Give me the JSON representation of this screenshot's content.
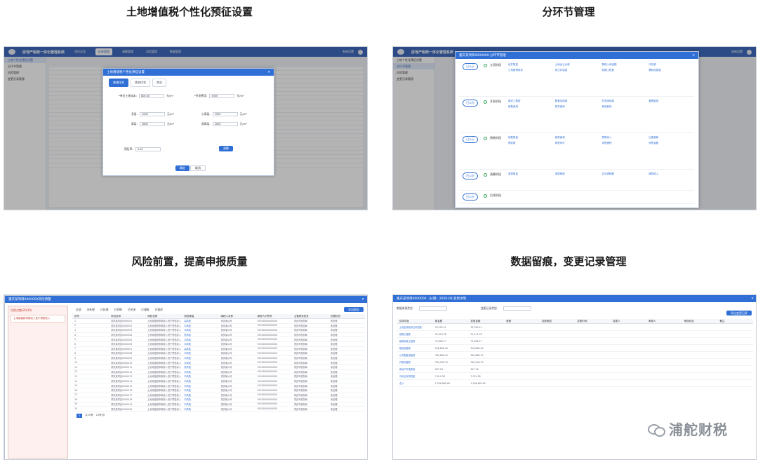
{
  "captions": {
    "q1": "土地增值税个性化预征设置",
    "q2": "分环节管理",
    "q3": "风险前置，提高申报质量",
    "q4": "数据留痕，变更记录管理"
  },
  "app": {
    "title": "房地产税统一体化管理系统",
    "nav": [
      "项目总览",
      "征收管理",
      "清算管理",
      "风险管理",
      "数据管理"
    ],
    "user": "系统设置"
  },
  "shot1": {
    "sidebar": [
      "土地个性化预征设置",
      "分环节管理",
      "风险管理",
      "变更记录管理"
    ],
    "modal_title": "土地增值税个性化预征设置",
    "tabs": [
      "普通住宅",
      "其他住宅",
      "商业"
    ],
    "fields": [
      {
        "label": "*单位土地成本:",
        "value": "800.00",
        "unit": "元/m²"
      },
      {
        "label": "*开发费用:",
        "value": "3000",
        "unit": "元/m²"
      },
      {
        "label": "多层:",
        "value": "1000",
        "unit": "元/m²"
      },
      {
        "label": "小高层:",
        "value": "1500",
        "unit": "元/m²"
      },
      {
        "label": "高层:",
        "value": "1800",
        "unit": "元/m²"
      },
      {
        "label": "超高层:",
        "value": "2000",
        "unit": "元/m²"
      }
    ],
    "rate_label": "预征率:",
    "rate_value": "0.10",
    "confirm": "确定",
    "cancel": "取消",
    "calc": "测算",
    "row_count": 24
  },
  "shot2": {
    "modal_title": "重庆某项目000000X-分环节管理",
    "stages": [
      {
        "tag": "已公示",
        "name": "立项阶段",
        "items": [
          "证件数量",
          "土地出让价款",
          "契税入库金额",
          "印花税",
          "土地取得成本",
          "拆迁补偿费",
          "前期工程费",
          "基础设施费"
        ]
      },
      {
        "tag": "已公示",
        "name": "开发阶段",
        "items": [
          "建安工程费",
          "配套设施费",
          "开发间接费",
          "管理费用",
          "销售费用",
          "财务费用",
          "其他费用"
        ]
      },
      {
        "tag": "已公示",
        "name": "销售阶段",
        "items": [
          "销售数量",
          "销售面积",
          "预售收入",
          "已缴税款",
          "预收款",
          "销售均价",
          "待售面积",
          "待售金额"
        ]
      },
      {
        "tag": "已公示",
        "name": "清算阶段",
        "items": [
          "清算数量",
          "清算税款",
          "应补退税额",
          "清算收入"
        ]
      },
      {
        "tag": "已公示",
        "name": "后续阶段",
        "items": []
      }
    ]
  },
  "shot3": {
    "modal_title": "重庆某项目000000X风险预警",
    "risk_title": "风险点数(20/20)",
    "risk_item": "土地增值税申报收入低于预售收入",
    "filters": [
      "全部",
      "未处理",
      "已处理",
      "已忽略",
      "已关闭",
      "已通报",
      "已整改"
    ],
    "columns": [
      "序号",
      "项目名称",
      "风险名称",
      "风险等级",
      "纳税人名称",
      "纳税人识别号",
      "主管税务机关",
      "处理状态"
    ],
    "rows": [
      [
        "1",
        "重庆某项目0000001",
        "土地增值税申报收入低于预售收入",
        "高风险",
        "重庆某公司",
        "9150000000000X",
        "重庆市税务局",
        "未处理"
      ],
      [
        "2",
        "重庆某项目0000002",
        "土地增值税申报收入低于预售收入",
        "中风险",
        "重庆某公司",
        "9150000000000X",
        "重庆市税务局",
        "未处理"
      ],
      [
        "3",
        "重庆某项目0000003",
        "土地增值税申报收入低于预售收入",
        "中风险",
        "重庆某公司",
        "9150000000000X",
        "重庆市税务局",
        "未处理"
      ],
      [
        "4",
        "重庆某项目0000004",
        "土地增值税申报收入低于预售收入",
        "低风险",
        "重庆某公司",
        "9150000000000X",
        "重庆市税务局",
        "未处理"
      ],
      [
        "5",
        "重庆某项目0000005",
        "土地增值税申报收入低于预售收入",
        "中风险",
        "重庆某公司",
        "9150000000000X",
        "重庆市税务局",
        "未处理"
      ],
      [
        "6",
        "重庆某项目0000006",
        "土地增值税申报收入低于预售收入",
        "中风险",
        "重庆某公司",
        "9150000000000X",
        "重庆市税务局",
        "未处理"
      ],
      [
        "7",
        "重庆某项目0000007",
        "土地增值税申报收入低于预售收入",
        "高风险",
        "重庆某公司",
        "9150000000000X",
        "重庆市税务局",
        "未处理"
      ],
      [
        "8",
        "重庆某项目0000008",
        "土地增值税申报收入低于预售收入",
        "中风险",
        "重庆某公司",
        "9150000000000X",
        "重庆市税务局",
        "未处理"
      ],
      [
        "9",
        "重庆某项目0000009",
        "土地增值税申报收入低于预售收入",
        "中风险",
        "重庆某公司",
        "9150000000000X",
        "重庆市税务局",
        "未处理"
      ],
      [
        "10",
        "重庆某项目0000010",
        "土地增值税申报收入低于预售收入",
        "中风险",
        "重庆某公司",
        "9150000000000X",
        "重庆市税务局",
        "未处理"
      ],
      [
        "11",
        "重庆某项目0000011",
        "土地增值税申报收入低于预售收入",
        "低风险",
        "重庆某公司",
        "9150000000000X",
        "重庆市税务局",
        "未处理"
      ],
      [
        "12",
        "重庆某项目0000012",
        "土地增值税申报收入低于预售收入",
        "中风险",
        "重庆某公司",
        "9150000000000X",
        "重庆市税务局",
        "未处理"
      ],
      [
        "13",
        "重庆某项目0000013",
        "土地增值税申报收入低于预售收入",
        "中风险",
        "重庆某公司",
        "9150000000000X",
        "重庆市税务局",
        "未处理"
      ],
      [
        "14",
        "重庆某项目0000014",
        "土地增值税申报收入低于预售收入",
        "中风险",
        "重庆某公司",
        "9150000000000X",
        "重庆市税务局",
        "未处理"
      ],
      [
        "15",
        "重庆某项目0000015",
        "土地增值税申报收入低于预售收入",
        "中风险",
        "重庆某公司",
        "9150000000000X",
        "重庆市税务局",
        "未处理"
      ],
      [
        "16",
        "重庆某项目0000016",
        "土地增值税申报收入低于预售收入",
        "中风险",
        "重庆某公司",
        "9150000000000X",
        "重庆市税务局",
        "未处理"
      ],
      [
        "17",
        "重庆某项目0000017",
        "土地增值税申报收入低于预售收入",
        "中风险",
        "重庆某公司",
        "9150000000000X",
        "重庆市税务局",
        "未处理"
      ],
      [
        "18",
        "重庆某项目0000018",
        "土地增值税申报收入低于预售收入",
        "中风险",
        "重庆某公司",
        "9150000000000X",
        "重庆市税务局",
        "未处理"
      ],
      [
        "19",
        "重庆某项目0000019",
        "土地增值税申报收入低于预售收入",
        "中风险",
        "重庆某公司",
        "9150000000000X",
        "重庆市税务局",
        "未处理"
      ],
      [
        "20",
        "重庆某项目0000020",
        "土地增值税申报收入低于预售收入",
        "中风险",
        "重庆某公司",
        "9150000000000X",
        "重庆市税务局",
        "未处理"
      ]
    ],
    "pager": {
      "current": "1",
      "total": "共20条",
      "size": "20条/页"
    },
    "export": "导出报告"
  },
  "shot4": {
    "modal_title": "重庆某项目000000X（分期）2020-08 变更详情",
    "filter1": "数据来源类型:",
    "filter2": "变更记录类型:",
    "columns": [
      "成本项目",
      "原金额",
      "变更金额",
      "差额",
      "变更原因",
      "变更时间",
      "变更人",
      "审核人",
      "审核状态",
      "备注"
    ],
    "rows": [
      [
        "土地征用及拆迁补偿费",
        "33,292.11",
        "33,292.11",
        "",
        "",
        "",
        "",
        "",
        "",
        ""
      ],
      [
        "前期工程费",
        "22,413.78",
        "22,413.78",
        "",
        "",
        "",
        "",
        "",
        "",
        ""
      ],
      [
        "建筑安装工程费",
        "73,896.17",
        "73,896.17",
        "",
        "",
        "",
        "",
        "",
        "",
        ""
      ],
      [
        "基础设施费",
        "208,886.09",
        "208,886.09",
        "",
        "",
        "",
        "",
        "",
        "",
        ""
      ],
      [
        "公共配套设施费",
        "380,886.19",
        "380,886.19",
        "",
        "",
        "",
        "",
        "",
        "",
        ""
      ],
      [
        "开发间接费",
        "780,008.79",
        "780,008.79",
        "",
        "",
        "",
        "",
        "",
        "",
        ""
      ],
      [
        "房地产开发费用",
        "367.18",
        "367.18",
        "",
        "",
        "",
        "",
        "",
        "",
        ""
      ],
      [
        "与转让有关税金",
        "7,019.38",
        "7,019.38",
        "",
        "",
        "",
        "",
        "",
        "",
        ""
      ],
      [
        "合计",
        "1,506,669.69",
        "1,506,669.69",
        "",
        "",
        "",
        "",
        "",
        "",
        ""
      ]
    ],
    "export": "导出变更记录",
    "watermark": "浦舵财税"
  }
}
